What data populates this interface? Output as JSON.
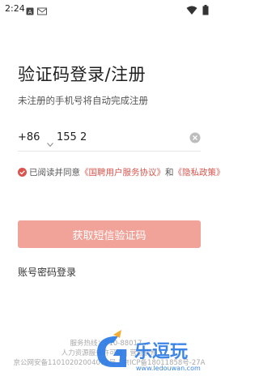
{
  "status_bar": {
    "time": "2:24",
    "icons": [
      "notification-a-icon",
      "mail-icon",
      "wifi-icon",
      "battery-icon"
    ]
  },
  "header": {
    "title": "验证码登录/注册",
    "subtitle": "未注册的手机号将自动完成注册"
  },
  "phone": {
    "country_code": "+86",
    "value": "155 2"
  },
  "agreement": {
    "prefix": "已阅读并同意",
    "link1": "《国聘用户服务协议》",
    "connector": "和",
    "link2": "《隐私政策》",
    "checked": true
  },
  "actions": {
    "submit_label": "获取短信验证码",
    "password_login": "账号密码登录"
  },
  "footer": {
    "line1": "服务热线：010-88017...",
    "line2": "人力资源服务许可证 | 营业执照",
    "line3": "京公网安备11010202004072号 | 京ICP备18011858号-27A"
  },
  "colors": {
    "accent": "#d9544d",
    "button": "#f1a39a",
    "watermark": "#2c7be5"
  },
  "watermark": {
    "text": "乐逗玩",
    "url": "www.ledouwan.com"
  }
}
